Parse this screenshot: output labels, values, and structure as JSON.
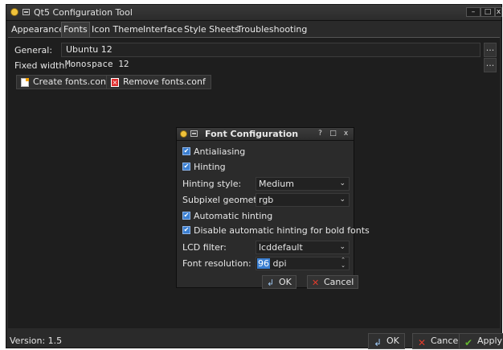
{
  "window": {
    "title": "Qt5 Configuration Tool",
    "controls": {
      "minimize": "–",
      "maximize": "□",
      "close": "x"
    }
  },
  "tabs": [
    {
      "label": "Appearance",
      "active": false
    },
    {
      "label": "Fonts",
      "active": true
    },
    {
      "label": "Icon Theme",
      "active": false
    },
    {
      "label": "Interface",
      "active": false
    },
    {
      "label": "Style Sheets",
      "active": false
    },
    {
      "label": "Troubleshooting",
      "active": false
    }
  ],
  "fonts": {
    "general_label": "General:",
    "general_value": "Ubuntu 12",
    "fixed_label": "Fixed width:",
    "fixed_value": "Monospace 12",
    "browse": "...",
    "create_button": "Create  fonts.conf",
    "remove_button": "Remove fonts.conf"
  },
  "dialog": {
    "title": "Font Configuration",
    "controls": {
      "help": "?",
      "maximize": "□",
      "close": "x"
    },
    "antialiasing": "Antialiasing",
    "hinting": "Hinting",
    "hinting_style_label": "Hinting style:",
    "hinting_style_value": "Medium",
    "subpixel_label": "Subpixel geometry:",
    "subpixel_value": "rgb",
    "auto_hinting": "Automatic hinting",
    "disable_bold": "Disable automatic hinting for bold fonts",
    "lcd_label": "LCD filter:",
    "lcd_value": "lcddefault",
    "resolution_label": "Font resolution:",
    "resolution_value": "96",
    "resolution_unit": " dpi",
    "ok": "OK",
    "cancel": "Cancel"
  },
  "footer": {
    "version": "Version: 1.5",
    "ok": "OK",
    "cancel": "Cancel",
    "apply": "Apply"
  },
  "icons": {
    "check": "✔",
    "arrow_down": "⌄",
    "ok_icon": "↲",
    "cancel_icon": "✕",
    "apply_icon": "✔"
  }
}
